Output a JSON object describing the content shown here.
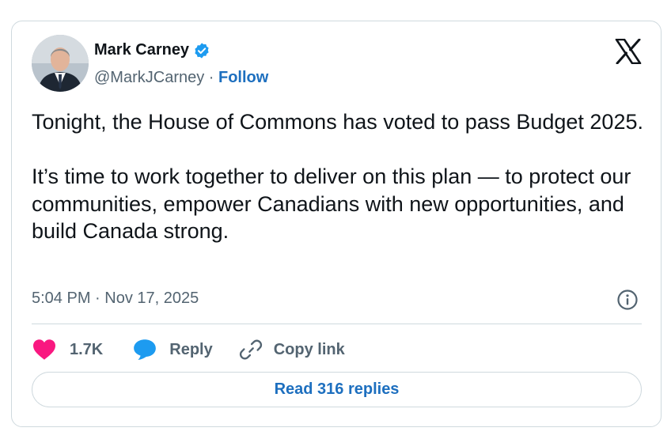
{
  "author": {
    "name": "Mark Carney",
    "handle": "@MarkJCarney",
    "separator": " · ",
    "follow_label": "Follow"
  },
  "tweet": {
    "text": "Tonight, the House of Commons has voted to pass Budget 2025.\n\nIt’s time to work together to deliver on this plan — to protect our communities, empower Canadians with new opportunities, and build Canada strong.",
    "time": "5:04 PM",
    "date": "Nov 17, 2025",
    "meta_separator": " · "
  },
  "actions": {
    "like_count": "1.7K",
    "reply_label": "Reply",
    "copy_link_label": "Copy link"
  },
  "read_replies_label": "Read 316 replies",
  "icons": {
    "verified": "verified-badge-icon",
    "logo": "x-logo-icon",
    "info": "info-icon",
    "like": "heart-icon",
    "reply": "speech-bubble-icon",
    "copy": "link-icon"
  },
  "colors": {
    "text": "#0f1419",
    "secondary": "#536471",
    "link": "#1d6fbf",
    "like": "#f91880",
    "reply": "#1d9bf0",
    "border": "#cfd9de"
  }
}
